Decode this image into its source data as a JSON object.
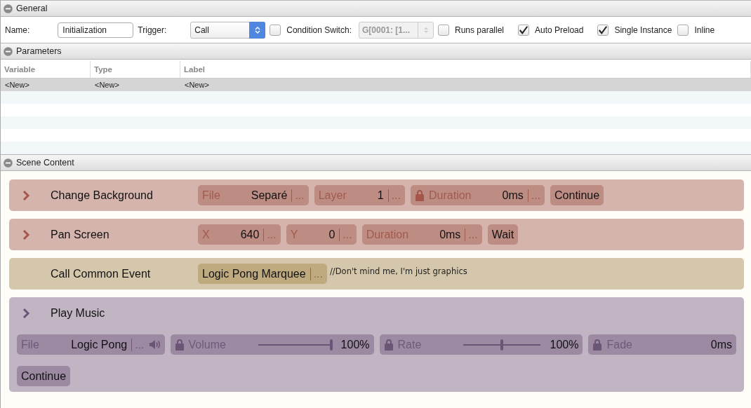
{
  "general": {
    "title": "General",
    "name_label": "Name:",
    "name_value": "Initialization",
    "trigger_label": "Trigger:",
    "trigger_value": "Call",
    "condition": {
      "label": "Condition Switch:",
      "checked": false
    },
    "switch_value": "G[0001: [1...",
    "switch_disabled": true,
    "checks": [
      {
        "label": "Runs parallel",
        "checked": false
      },
      {
        "label": "Auto Preload",
        "checked": true
      },
      {
        "label": "Single Instance",
        "checked": true
      },
      {
        "label": "Inline",
        "checked": false
      }
    ]
  },
  "parameters": {
    "title": "Parameters",
    "columns": [
      "Variable",
      "Type",
      "Label"
    ],
    "rows": [
      {
        "cells": [
          "<New>",
          "<New>",
          "<New>"
        ],
        "selected": true
      }
    ]
  },
  "scene_content": {
    "title": "Scene Content",
    "commands": [
      {
        "kind": "visual",
        "chevron": true,
        "title": "Change Background",
        "rows": [
          [
            {
              "kind": "field",
              "label": "File",
              "value": "Separé",
              "more": "...",
              "locked": false
            },
            {
              "kind": "field",
              "label": "Layer",
              "value": "1",
              "more": "...",
              "locked": false
            },
            {
              "kind": "field",
              "label": "Duration",
              "value": "0ms",
              "more": "...",
              "locked": true
            },
            {
              "kind": "button",
              "label": "Continue"
            }
          ]
        ]
      },
      {
        "kind": "visual",
        "chevron": true,
        "title": "Pan Screen",
        "rows": [
          [
            {
              "kind": "field",
              "label": "X",
              "value": "640",
              "more": "...",
              "locked": false
            },
            {
              "kind": "field",
              "label": "Y",
              "value": "0",
              "more": "...",
              "locked": false
            },
            {
              "kind": "field",
              "label": "Duration",
              "value": "0ms",
              "more": "...",
              "locked": false
            },
            {
              "kind": "button",
              "label": "Wait"
            }
          ]
        ]
      },
      {
        "kind": "event",
        "chevron": false,
        "title": "Call Common Event",
        "comment": "//Don't mind me, I'm just graphics",
        "rows": [
          [
            {
              "kind": "field",
              "value": "Logic Pong Marquee",
              "more": "...",
              "locked": false
            }
          ]
        ]
      },
      {
        "kind": "audio",
        "chevron": true,
        "title": "Play Music",
        "rows": [
          [
            {
              "kind": "field",
              "label": "File",
              "value": "Logic Pong",
              "more": "...",
              "locked": false,
              "audio": true
            },
            {
              "kind": "slider",
              "label": "Volume",
              "level": 1,
              "reading": "100%",
              "locked": true
            },
            {
              "kind": "slider",
              "label": "Rate",
              "level": 0.5,
              "reading": "100%",
              "locked": true
            },
            {
              "kind": "field",
              "label": "Fade",
              "value": "0ms",
              "locked": true
            }
          ],
          [
            {
              "kind": "button",
              "label": "Continue"
            }
          ]
        ]
      }
    ]
  }
}
